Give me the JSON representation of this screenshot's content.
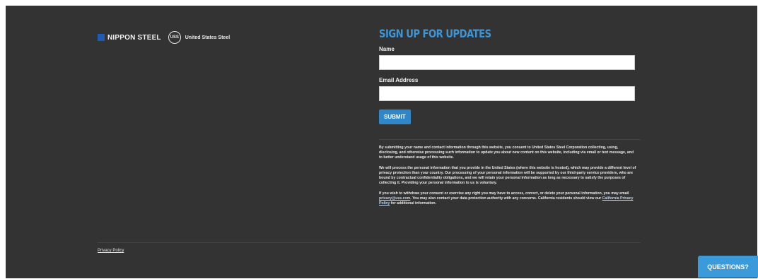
{
  "brand": {
    "nippon_steel": "NIPPON STEEL",
    "uss_badge": "USS",
    "united_states_steel": "United States Steel"
  },
  "signup": {
    "heading": "SIGN UP FOR UPDATES",
    "name_label": "Name",
    "name_value": "",
    "email_label": "Email Address",
    "email_value": "",
    "submit_label": "SUBMIT"
  },
  "legal": {
    "paragraph1": "By submitting your name and contact information through this website, you consent to United States Steel Corporation collecting, using, disclosing, and otherwise processing such information to update you about new content on this website, including via email or text message, and to better understand usage of this website.",
    "paragraph2": "We will process the personal information that you provide in the United States (where this website is hosted), which may provide a different level of privacy protection than your country. Our processing of your personal information will be supported by our third-party service providers, who are bound by contractual confidentiality obligations, and we will retain your personal information as long as necessary to satisfy the purposes of collecting it. Providing your personal information to us is voluntary.",
    "paragraph3_start": "If you wish to withdraw your consent or exercise any right you may have to access, correct, or delete your personal information, you may email ",
    "email_link": "privacy@uss.com",
    "paragraph3_mid": ". You may also contact your data protection authority with any concerns. California residents should view our ",
    "ca_link": "California Privacy Policy",
    "paragraph3_end": " for additional information."
  },
  "footer": {
    "privacy_link": "Privacy Policy",
    "questions_button": "QUESTIONS?"
  },
  "colors": {
    "background": "#333333",
    "accent": "#3d95d6",
    "button": "#2f86c9",
    "nippon_blue": "#1f5bb5"
  }
}
